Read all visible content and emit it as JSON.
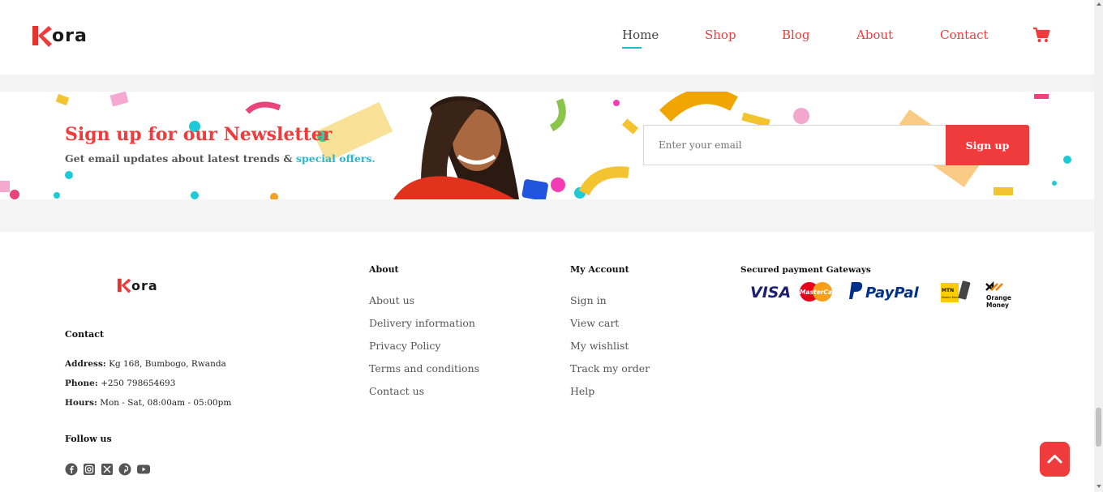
{
  "brand": {
    "name": "ora",
    "accent": "#ef3b3b",
    "highlight": "#25b9d0"
  },
  "nav": {
    "items": [
      {
        "label": "Home",
        "active": true
      },
      {
        "label": "Shop"
      },
      {
        "label": "Blog"
      },
      {
        "label": "About"
      },
      {
        "label": "Contact"
      }
    ],
    "cart_icon": "cart-icon"
  },
  "newsletter": {
    "title": "Sign up for our Newsletter",
    "subtitle": "Get email updates about latest trends & ",
    "subtitle_highlight": "special offers.",
    "email_placeholder": "Enter your email",
    "button_label": "Sign up"
  },
  "footer": {
    "contact": {
      "heading": "Contact",
      "address_label": "Address:",
      "address": "Kg 168, Bumbogo, Rwanda",
      "phone_label": "Phone:",
      "phone": "+250 798654693",
      "hours_label": "Hours:",
      "hours": "Mon - Sat, 08:00am - 05:00pm"
    },
    "follow": {
      "heading": "Follow us",
      "icons": [
        "facebook-icon",
        "instagram-icon",
        "x-twitter-icon",
        "pinterest-icon",
        "youtube-icon"
      ]
    },
    "about": {
      "heading": "About",
      "links": [
        "About us",
        "Delivery information",
        "Privacy Policy",
        "Terms and conditions",
        "Contact us"
      ]
    },
    "account": {
      "heading": "My Account",
      "links": [
        "Sign in",
        "View cart",
        "My wishlist",
        "Track my order",
        "Help"
      ]
    },
    "payments": {
      "heading": "Secured payment Gateways",
      "visa": "VISA",
      "mastercard": "MasterCard",
      "paypal": "PayPal",
      "mtn": "MTN",
      "mtn_sub": "Mobile Money",
      "orange_1": "Orange",
      "orange_2": "Money"
    }
  },
  "scroll_top_icon": "chevron-up-icon"
}
